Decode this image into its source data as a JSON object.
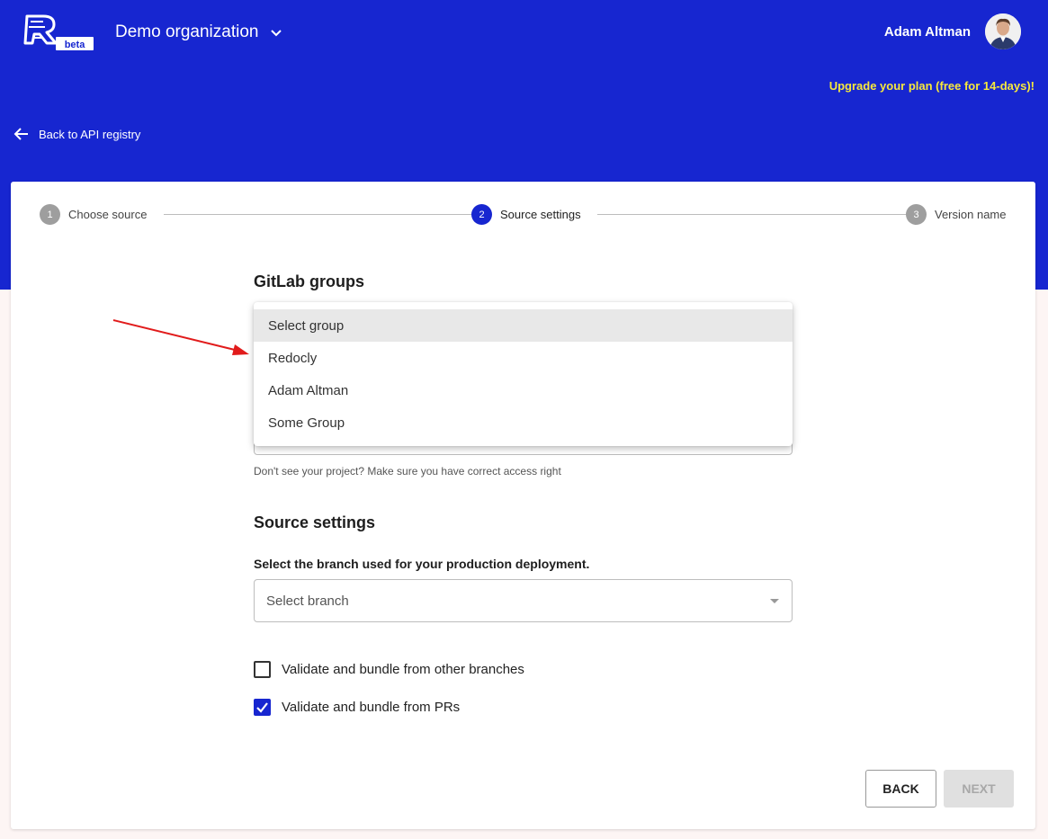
{
  "header": {
    "logo_badge": "beta",
    "org_name": "Demo organization",
    "user_name": "Adam Altman",
    "upgrade_text": "Upgrade your plan (free for 14-days)!",
    "back_label": "Back to API registry"
  },
  "stepper": {
    "steps": [
      {
        "num": "1",
        "label": "Choose source",
        "state": "done"
      },
      {
        "num": "2",
        "label": "Source settings",
        "state": "active"
      },
      {
        "num": "3",
        "label": "Version name",
        "state": "pending"
      }
    ]
  },
  "gitlab": {
    "title": "GitLab groups",
    "options": [
      "Select group",
      "Redocly",
      "Adam Altman",
      "Some Group"
    ],
    "selected": "Select group",
    "helper": "Don't see your project? Make sure you have correct access right"
  },
  "source_settings": {
    "title": "Source settings",
    "branch_label": "Select the branch used for your production deployment.",
    "branch_placeholder": "Select branch",
    "checkboxes": [
      {
        "label": "Validate and bundle from other branches",
        "checked": false
      },
      {
        "label": "Validate and bundle from PRs",
        "checked": true
      }
    ]
  },
  "actions": {
    "back_label": "BACK",
    "next_label": "NEXT",
    "next_disabled": true
  },
  "colors": {
    "brand_blue": "#1726d0",
    "upgrade_yellow": "#f7e93c",
    "annotation_red": "#e11b1b"
  },
  "icons": {
    "logo": "redocly-logo",
    "org_chevron": "chevron-down-icon",
    "back": "arrow-left-icon",
    "checkbox_checked": "checkmark-icon"
  }
}
